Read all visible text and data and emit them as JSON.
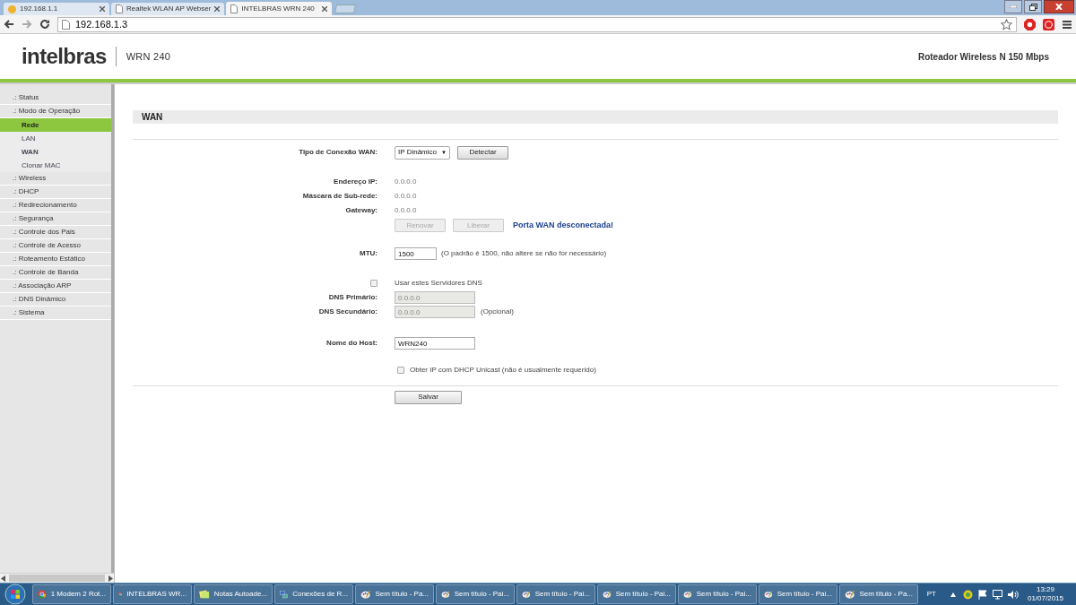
{
  "browser": {
    "tabs": [
      {
        "title": "192.168.1.1",
        "kind": "router",
        "selected": false
      },
      {
        "title": "Realtek WLAN AP Webser",
        "kind": "page",
        "selected": false
      },
      {
        "title": "INTELBRAS WRN 240",
        "kind": "page",
        "selected": true
      }
    ],
    "address": "192.168.1.3"
  },
  "header": {
    "logo": "intelbras",
    "model": "WRN 240",
    "product": "Roteador Wireless N 150 Mbps"
  },
  "sidebar": {
    "items": [
      {
        "label": ".: Status",
        "selected": false
      },
      {
        "label": ".: Modo de Operação",
        "selected": false,
        "children": [
          {
            "label": "Rede",
            "selected": true,
            "current": false
          },
          {
            "label": "LAN",
            "selected": false,
            "current": false
          },
          {
            "label": "WAN",
            "selected": false,
            "current": true
          },
          {
            "label": "Clonar MAC",
            "selected": false,
            "current": false
          }
        ]
      },
      {
        "label": ".: Wireless",
        "selected": false
      },
      {
        "label": ".: DHCP",
        "selected": false
      },
      {
        "label": ".: Redirecionamento",
        "selected": false
      },
      {
        "label": ".: Segurança",
        "selected": false
      },
      {
        "label": ".: Controle dos Pais",
        "selected": false
      },
      {
        "label": ".: Controle de Acesso",
        "selected": false
      },
      {
        "label": ".: Roteamento Estático",
        "selected": false
      },
      {
        "label": ".: Controle de Banda",
        "selected": false
      },
      {
        "label": ".: Associação ARP",
        "selected": false
      },
      {
        "label": ".: DNS Dinâmico",
        "selected": false
      },
      {
        "label": ".: Sistema",
        "selected": false
      }
    ]
  },
  "page": {
    "title": "WAN",
    "connection_type": {
      "label": "Tipo de Conexão WAN:",
      "value": "IP Dinâmico",
      "arrow": "▼",
      "button": "Detectar"
    },
    "info": [
      {
        "label": "Endereço IP:",
        "value": "0.0.0.0"
      },
      {
        "label": "Máscara de Sub-rede:",
        "value": "0.0.0.0"
      },
      {
        "label": "Gateway:",
        "value": "0.0.0.0"
      }
    ],
    "actions": [
      {
        "label": "Renovar",
        "disabled": true
      },
      {
        "label": "Liberar",
        "disabled": true
      }
    ],
    "status": "Porta WAN desconectada!",
    "mtu": {
      "label": "MTU:",
      "value": "1500",
      "note": "(O padrão é 1500, não altere se não for necessário)"
    },
    "use_dns": {
      "label": "Usar estes Servidores DNS",
      "checked": false
    },
    "dns": [
      {
        "label": "DNS Primário:",
        "value": "0.0.0.0",
        "disabled": true
      },
      {
        "label": "DNS Secundário:",
        "value": "0.0.0.0",
        "disabled": true,
        "note": "(Opcional)"
      }
    ],
    "host": {
      "label": "Nome do Host:",
      "value": "WRN240"
    },
    "unicast": {
      "label": "Obter IP com DHCP Unicast (não é usualmente requerido)",
      "checked": false
    },
    "save": "Salvar"
  },
  "taskbar": {
    "items": [
      {
        "label": "1 Modem 2 Rot...",
        "kind": "chrome"
      },
      {
        "label": "INTELBRAS WR...",
        "kind": "chrome"
      },
      {
        "label": "Notas Autoade...",
        "kind": "notes"
      },
      {
        "label": "Conexões de R...",
        "kind": "network"
      },
      {
        "label": "Sem título - Pa...",
        "kind": "paint"
      },
      {
        "label": "Sem título - Pai...",
        "kind": "paint"
      },
      {
        "label": "Sem título - Pai...",
        "kind": "paint"
      },
      {
        "label": "Sem título - Pai...",
        "kind": "paint"
      },
      {
        "label": "Sem título - Pai...",
        "kind": "paint"
      },
      {
        "label": "Sem título - Pai...",
        "kind": "paint"
      },
      {
        "label": "Sem título - Pa...",
        "kind": "paint"
      }
    ],
    "language": "PT",
    "time": "13:29",
    "date": "01/07/2015"
  }
}
